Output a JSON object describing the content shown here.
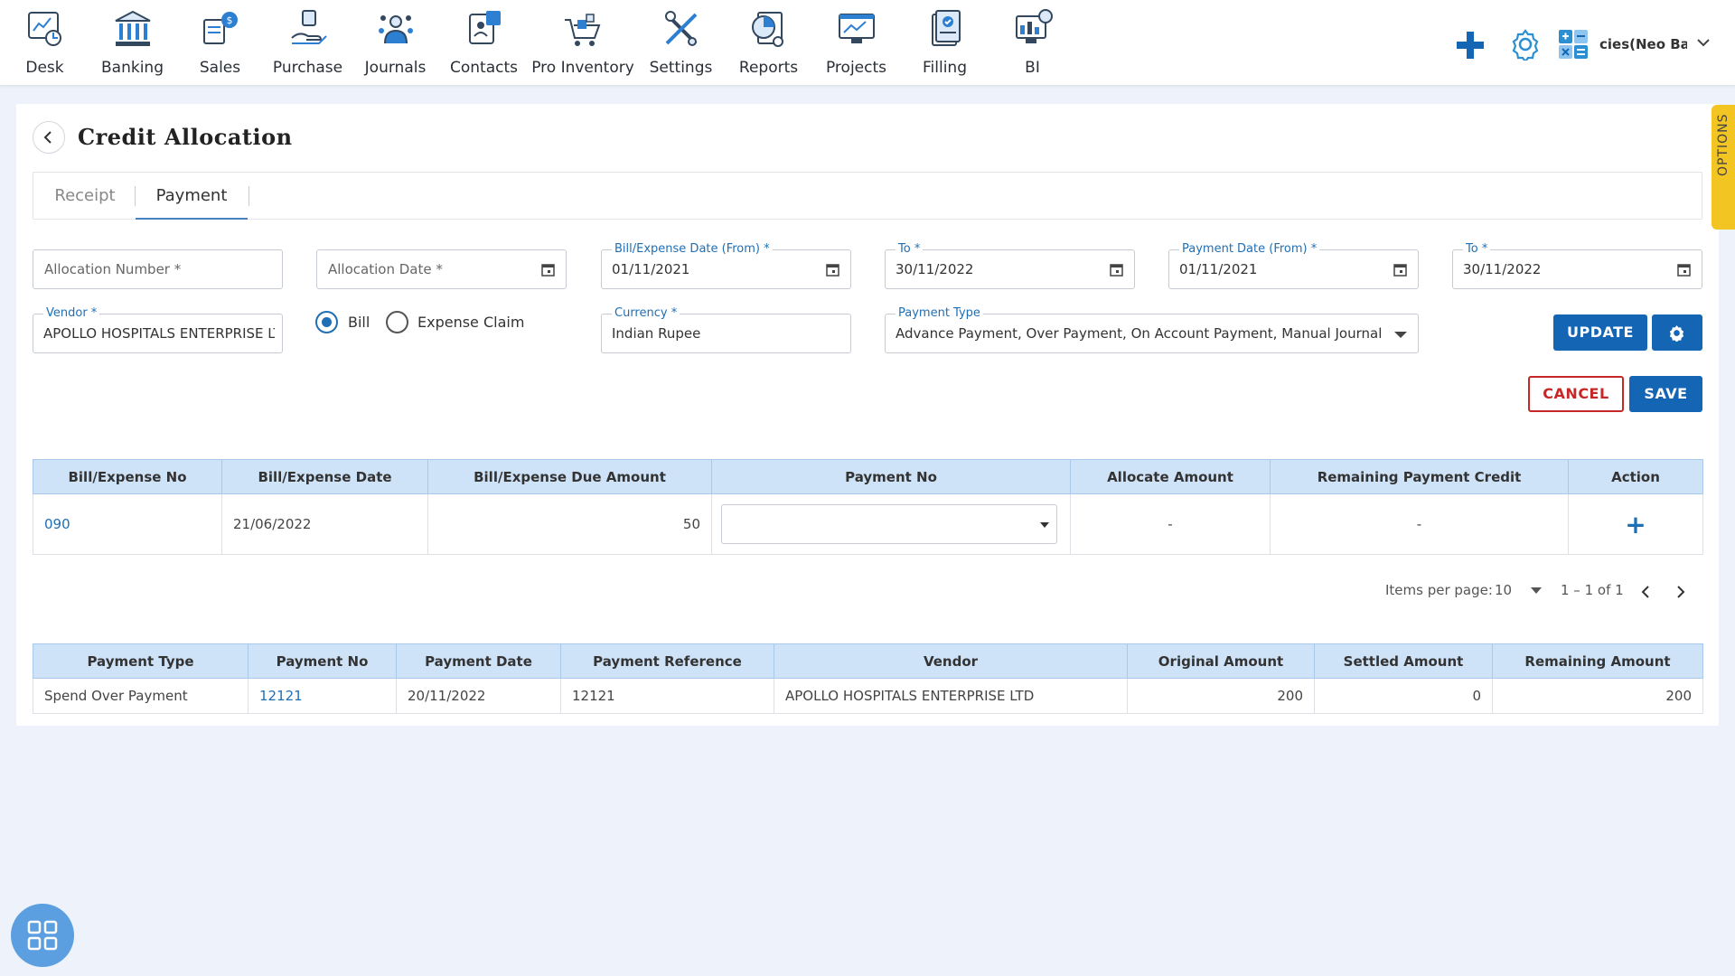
{
  "nav": {
    "items": [
      {
        "label": "Desk",
        "icon": "desk-icon"
      },
      {
        "label": "Banking",
        "icon": "bank-icon"
      },
      {
        "label": "Sales",
        "icon": "sales-icon"
      },
      {
        "label": "Purchase",
        "icon": "purchase-icon"
      },
      {
        "label": "Journals",
        "icon": "journals-icon"
      },
      {
        "label": "Contacts",
        "icon": "contacts-icon"
      },
      {
        "label": "Pro Inventory",
        "icon": "inventory-icon"
      },
      {
        "label": "Settings",
        "icon": "settings-tools-icon"
      },
      {
        "label": "Reports",
        "icon": "reports-icon"
      },
      {
        "label": "Projects",
        "icon": "projects-icon"
      },
      {
        "label": "Filling",
        "icon": "filling-icon"
      },
      {
        "label": "BI",
        "icon": "bi-icon"
      }
    ],
    "company": "cies(Neo Ban"
  },
  "page": {
    "title": "Credit Allocation",
    "tabs": [
      {
        "label": "Receipt"
      },
      {
        "label": "Payment"
      }
    ],
    "options_label": "OPTIONS"
  },
  "form": {
    "allocation_number_placeholder": "Allocation Number *",
    "allocation_date_placeholder": "Allocation Date *",
    "bill_date_from": {
      "label": "Bill/Expense Date (From) *",
      "value": "01/11/2021"
    },
    "bill_date_to": {
      "label": "To *",
      "value": "30/11/2022"
    },
    "payment_date_from": {
      "label": "Payment Date (From) *",
      "value": "01/11/2021"
    },
    "payment_date_to": {
      "label": "To *",
      "value": "30/11/2022"
    },
    "vendor": {
      "label": "Vendor *",
      "value": "APOLLO HOSPITALS ENTERPRISE LTD"
    },
    "radio_bill": "Bill",
    "radio_expense": "Expense Claim",
    "currency": {
      "label": "Currency *",
      "value": "Indian Rupee"
    },
    "payment_type": {
      "label": "Payment Type",
      "value": "Advance Payment, Over Payment, On Account Payment, Manual Journal"
    },
    "update_label": "UPDATE",
    "cancel_label": "CANCEL",
    "save_label": "SAVE"
  },
  "bills_table": {
    "headers": [
      "Bill/Expense No",
      "Bill/Expense Date",
      "Bill/Expense Due Amount",
      "Payment No",
      "Allocate Amount",
      "Remaining Payment Credit",
      "Action"
    ],
    "rows": [
      {
        "no": "090",
        "date": "21/06/2022",
        "due": "50",
        "payment_no": "",
        "allocate": "-",
        "remaining": "-"
      }
    ]
  },
  "pager": {
    "items_label": "Items per page:",
    "items_value": "10",
    "range": "1 – 1 of 1"
  },
  "payments_table": {
    "headers": [
      "Payment Type",
      "Payment No",
      "Payment Date",
      "Payment Reference",
      "Vendor",
      "Original Amount",
      "Settled Amount",
      "Remaining Amount"
    ],
    "rows": [
      {
        "type": "Spend Over Payment",
        "no": "12121",
        "date": "20/11/2022",
        "ref": "12121",
        "vendor": "APOLLO HOSPITALS ENTERPRISE LTD",
        "original": "200",
        "settled": "0",
        "remaining": "200"
      }
    ]
  },
  "colors": {
    "primary": "#1565b5",
    "cancel": "#c62828",
    "table_header": "#cfe3f8",
    "options_tab": "#f3c523"
  }
}
